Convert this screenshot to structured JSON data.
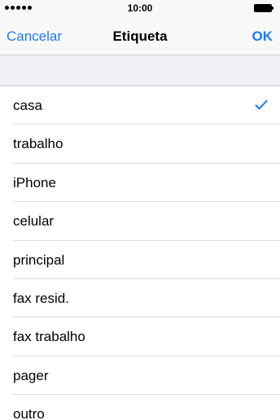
{
  "status_bar": {
    "time": "10:00",
    "signal_icon": "signal-dots-icon",
    "battery_icon": "battery-full-icon"
  },
  "nav": {
    "cancel_label": "Cancelar",
    "title": "Etiqueta",
    "ok_label": "OK"
  },
  "labels": {
    "selected_index": 0,
    "items": [
      {
        "label": "casa",
        "selected": true
      },
      {
        "label": "trabalho",
        "selected": false
      },
      {
        "label": "iPhone",
        "selected": false
      },
      {
        "label": "celular",
        "selected": false
      },
      {
        "label": "principal",
        "selected": false
      },
      {
        "label": "fax resid.",
        "selected": false
      },
      {
        "label": "fax trabalho",
        "selected": false
      },
      {
        "label": "pager",
        "selected": false
      },
      {
        "label": "outro",
        "selected": false
      }
    ]
  },
  "colors": {
    "accent": "#1a7cf4",
    "bar_background": "#f8f8f8",
    "section_background": "#efeff4"
  }
}
